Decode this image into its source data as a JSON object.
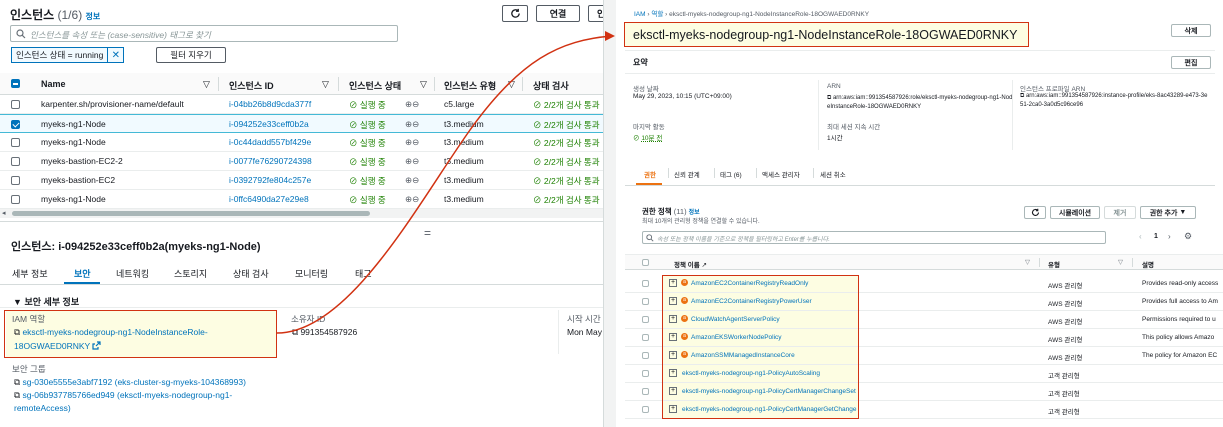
{
  "left": {
    "title": "인스턴스",
    "count": "(1/6)",
    "info": "정보",
    "buttons": {
      "refresh_icon": "refresh-icon",
      "connect": "연결",
      "more": "인"
    },
    "search_placeholder": "인스턴스를 속성 또는 (case-sensitive) 태그로 찾기",
    "filter_chip": "인스턴스 상태 = running",
    "clear_filters": "필터 지우기",
    "columns": [
      "Name",
      "인스턴스 ID",
      "인스턴스 상태",
      "인스턴스 유형",
      "상태 검사"
    ],
    "rows": [
      {
        "name": "karpenter.sh/provisioner-name/default",
        "id": "i-04bb26b8d9cda377f",
        "state": "실행 중",
        "type": "c5.large",
        "check": "2/2개 검사 통과",
        "selected": false
      },
      {
        "name": "myeks-ng1-Node",
        "id": "i-094252e33ceff0b2a",
        "state": "실행 중",
        "type": "t3.medium",
        "check": "2/2개 검사 통과",
        "selected": true
      },
      {
        "name": "myeks-ng1-Node",
        "id": "i-0c44dadd557bf429e",
        "state": "실행 중",
        "type": "t3.medium",
        "check": "2/2개 검사 통과",
        "selected": false
      },
      {
        "name": "myeks-bastion-EC2-2",
        "id": "i-0077fe76290724398",
        "state": "실행 중",
        "type": "t3.medium",
        "check": "2/2개 검사 통과",
        "selected": false
      },
      {
        "name": "myeks-bastion-EC2",
        "id": "i-0392792fe804c257e",
        "state": "실행 중",
        "type": "t3.medium",
        "check": "2/2개 검사 통과",
        "selected": false
      },
      {
        "name": "myeks-ng1-Node",
        "id": "i-0ffc6490da27e29e8",
        "state": "실행 중",
        "type": "t3.medium",
        "check": "2/2개 검사 통과",
        "selected": false
      }
    ],
    "divider": "=",
    "detail_title": "인스턴스: i-094252e33ceff0b2a(myeks-ng1-Node)",
    "tabs": [
      "세부 정보",
      "보안",
      "네트워킹",
      "스토리지",
      "상태 검사",
      "모니터링",
      "태그"
    ],
    "active_tab": "보안",
    "section": "보안 세부 정보",
    "iam_label": "IAM 역할",
    "iam_role_line1": "eksctl-myeks-nodegroup-ng1-NodeInstanceRole-",
    "iam_role_line2": "18OGWAED0RNKY",
    "owner_label": "소유자 ID",
    "owner_value": "991354587926",
    "launch_label": "시작 시간",
    "launch_value": "Mon May",
    "sg_label": "보안 그룹",
    "sg1": "sg-030e5555e3abf7192 (eks-cluster-sg-myeks-104368993)",
    "sg2_line1": "sg-06b937785766ed949 (eksctl-myeks-nodegroup-ng1-",
    "sg2_line2": "remoteAccess)"
  },
  "right": {
    "breadcrumb": [
      "IAM",
      "역할",
      "eksctl-myeks-nodegroup-ng1-NodeInstanceRole-18OGWAED0RNKY"
    ],
    "role_title": "eksctl-myeks-nodegroup-ng1-NodeInstanceRole-18OGWAED0RNKY",
    "delete": "삭제",
    "summary": "요약",
    "edit": "편집",
    "created_label": "생성 날짜",
    "created_value": "May 29, 2023, 10:15 (UTC+09:00)",
    "arn_label": "ARN",
    "arn_value": "arn:aws:iam::991354587926:role/eksctl-myeks-nodegroup-ng1-NodeInstanceRole-18OGWAED0RNKY",
    "profile_label": "인스턴스 프로파일 ARN",
    "profile_value": "arn:aws:iam::991354587926:instance-profile/eks-8ac43289-e473-3e51-2ca0-3a0d5c96ce96",
    "last_activity_label": "마지막 활동",
    "last_activity_value": "10분 전",
    "max_session_label": "최대 세션 지속 시간",
    "max_session_value": "1시간",
    "tabs": [
      "권한",
      "신뢰 관계",
      "태그 (6)",
      "액세스 관리자",
      "세션 취소"
    ],
    "active_tab": "권한",
    "policies_title": "권한 정책",
    "policies_count": "(11)",
    "policies_info": "정보",
    "policies_sub": "최대 10개의 관리형 정책을 연결할 수 있습니다.",
    "simulate": "시뮬레이션",
    "remove": "제거",
    "add_perm": "권한 추가",
    "search_placeholder": "속성 또는 정책 이름을 기준으로 정책을 필터링하고 Enter를 누릅니다.",
    "page": "1",
    "columns": [
      "정책 이름",
      "유형",
      "설명"
    ],
    "policies": [
      {
        "name": "AmazonEC2ContainerRegistryReadOnly",
        "aws": true,
        "type": "AWS 관리형",
        "desc": "Provides read-only access"
      },
      {
        "name": "AmazonEC2ContainerRegistryPowerUser",
        "aws": true,
        "type": "AWS 관리형",
        "desc": "Provides full access to Am"
      },
      {
        "name": "CloudWatchAgentServerPolicy",
        "aws": true,
        "type": "AWS 관리형",
        "desc": "Permissions required to u"
      },
      {
        "name": "AmazonEKSWorkerNodePolicy",
        "aws": true,
        "type": "AWS 관리형",
        "desc": "This policy allows Amazo"
      },
      {
        "name": "AmazonSSMManagedInstanceCore",
        "aws": true,
        "type": "AWS 관리형",
        "desc": "The policy for Amazon EC"
      },
      {
        "name": "eksctl-myeks-nodegroup-ng1-PolicyAutoScaling",
        "aws": false,
        "type": "고객 관리형",
        "desc": ""
      },
      {
        "name": "eksctl-myeks-nodegroup-ng1-PolicyCertManagerChangeSet",
        "aws": false,
        "type": "고객 관리형",
        "desc": ""
      },
      {
        "name": "eksctl-myeks-nodegroup-ng1-PolicyCertManagerGetChange",
        "aws": false,
        "type": "고객 관리형",
        "desc": ""
      }
    ]
  },
  "colors": {
    "link": "#0073bb",
    "ok": "#1d8102",
    "highlight": "#d13212",
    "aws_orange": "#ec7211"
  }
}
